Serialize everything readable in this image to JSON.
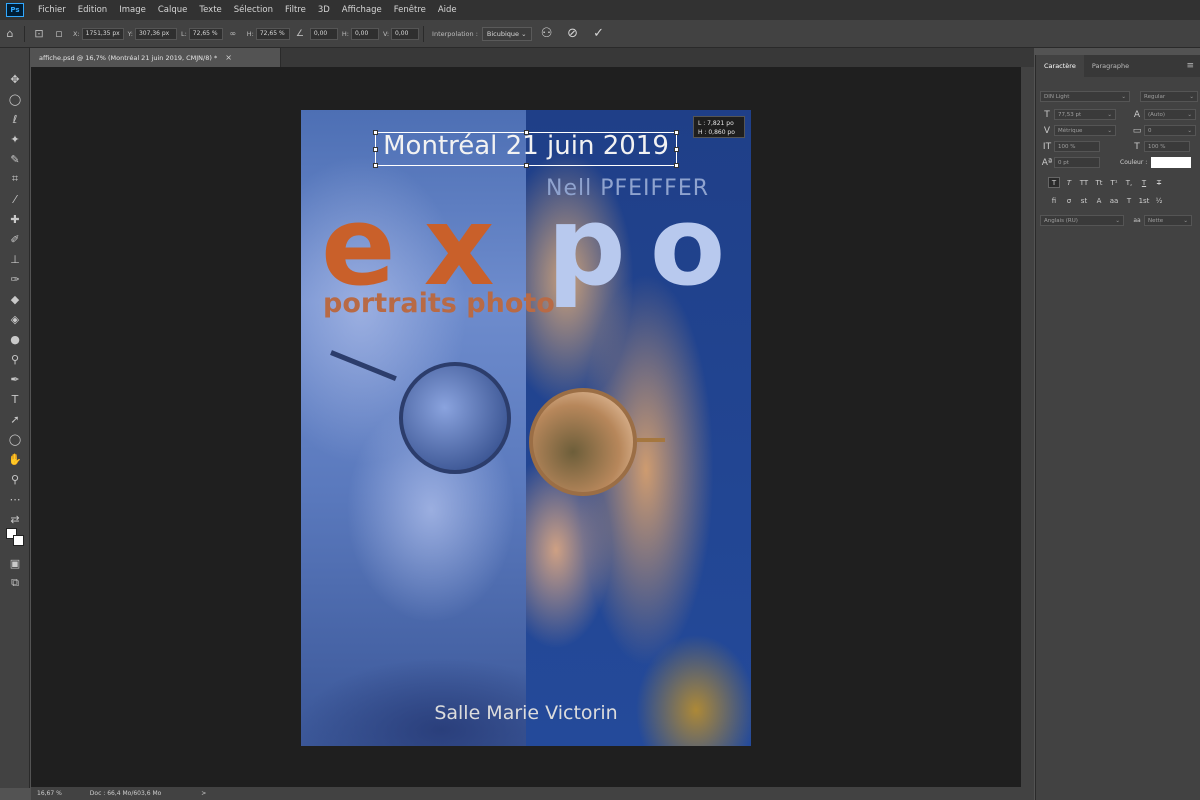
{
  "app": {
    "logo": "Ps"
  },
  "menu": [
    "Fichier",
    "Edition",
    "Image",
    "Calque",
    "Texte",
    "Sélection",
    "Filtre",
    "3D",
    "Affichage",
    "Fenêtre",
    "Aide"
  ],
  "options": {
    "x_label": "X:",
    "x_value": "1751,35 px",
    "y_label": "Y:",
    "y_value": "307,36 px",
    "l_label": "L:",
    "l_value": "72,65 %",
    "h_label": "H:",
    "h_value": "72,65 %",
    "angle_value": "0,00",
    "hskew_label": "H:",
    "hskew_value": "0,00",
    "vskew_label": "V:",
    "vskew_value": "0,00",
    "interp_label": "Interpolation :",
    "interp_value": "Bicubique"
  },
  "document": {
    "tab_title": "affiche.psd @ 16,7% (Montréal 21 juin 2019, CMJN/8) *",
    "close": "×"
  },
  "poster": {
    "date": "Montréal 21 juin 2019",
    "artist": "Nell PFEIFFER",
    "title_left": "ex",
    "title_right": "po",
    "subtitle": "portraits photo",
    "venue": "Salle Marie Victorin",
    "info_l": "L : 7,821 po",
    "info_h": "H : 0,860 po"
  },
  "status": {
    "zoom": "16,67 %",
    "doc": "Doc : 66,4 Mo/603,6 Mo",
    "arrow": ">"
  },
  "panel": {
    "tabs": [
      "Caractère",
      "Paragraphe"
    ],
    "menu_icon": "≡",
    "font_family": "DIN Light",
    "font_style": "Regular",
    "font_size": "77,53 pt",
    "leading": "(Auto)",
    "kerning": "Métrique",
    "tracking": "0",
    "vscale": "100 %",
    "hscale": "100 %",
    "baseline": "0 pt",
    "color_label": "Couleur :",
    "color_value": "#ffffff",
    "type_buttons": [
      "T",
      "T",
      "TT",
      "Tt",
      "T¹",
      "T,",
      "T",
      "T"
    ],
    "ot_buttons": [
      "fi",
      "σ",
      "st",
      "A",
      "aa",
      "T",
      "1st",
      "½"
    ],
    "language": "Anglais (RU)",
    "aa_label": "aa",
    "aa_value": "Nette"
  }
}
